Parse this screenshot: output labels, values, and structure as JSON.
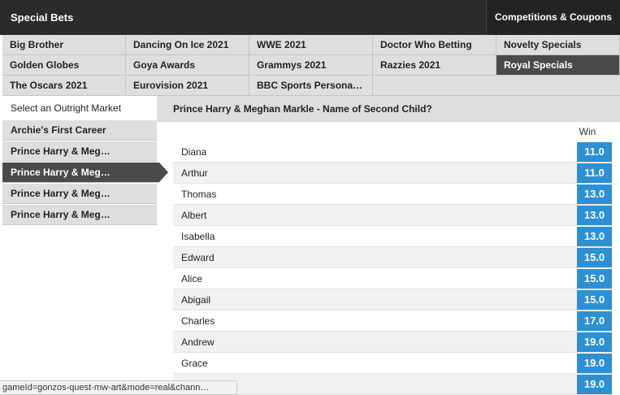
{
  "header": {
    "title": "Special Bets",
    "competitions_label": "Competitions & Coupons"
  },
  "categories": [
    {
      "label": "Big Brother"
    },
    {
      "label": "Dancing On Ice 2021"
    },
    {
      "label": "WWE 2021"
    },
    {
      "label": "Doctor Who Betting"
    },
    {
      "label": "Novelty Specials"
    },
    {
      "label": "Golden Globes"
    },
    {
      "label": "Goya Awards"
    },
    {
      "label": "Grammys 2021"
    },
    {
      "label": "Razzies 2021"
    },
    {
      "label": "Royal Specials",
      "active": true
    },
    {
      "label": "The Oscars 2021"
    },
    {
      "label": "Eurovision 2021"
    },
    {
      "label": "BBC Sports Persona…"
    }
  ],
  "sidebar": {
    "heading": "Select an Outright Market",
    "items": [
      {
        "label": "Archie's First Career"
      },
      {
        "label": "Prince Harry & Meg…"
      },
      {
        "label": "Prince Harry & Meg…",
        "active": true
      },
      {
        "label": "Prince Harry & Meg…"
      },
      {
        "label": "Prince Harry & Meg…"
      }
    ]
  },
  "market": {
    "title": "Prince Harry & Meghan Markle - Name of Second Child?",
    "win_label": "Win",
    "selections": [
      {
        "name": "Diana",
        "odds": "11.0"
      },
      {
        "name": "Arthur",
        "odds": "11.0"
      },
      {
        "name": "Thomas",
        "odds": "13.0"
      },
      {
        "name": "Albert",
        "odds": "13.0"
      },
      {
        "name": "Isabella",
        "odds": "13.0"
      },
      {
        "name": "Edward",
        "odds": "15.0"
      },
      {
        "name": "Alice",
        "odds": "15.0"
      },
      {
        "name": "Abigail",
        "odds": "15.0"
      },
      {
        "name": "Charles",
        "odds": "17.0"
      },
      {
        "name": "Andrew",
        "odds": "19.0"
      },
      {
        "name": "Grace",
        "odds": "19.0"
      },
      {
        "name": "",
        "odds": "19.0"
      }
    ]
  },
  "status_bar": {
    "url": "gameId=gonzos-quest-mw-art&mode=real&chann…"
  },
  "colors": {
    "topbar": "#2b2b2b",
    "active_tab": "#4a4a4a",
    "odds_button": "#2d8fd5"
  }
}
